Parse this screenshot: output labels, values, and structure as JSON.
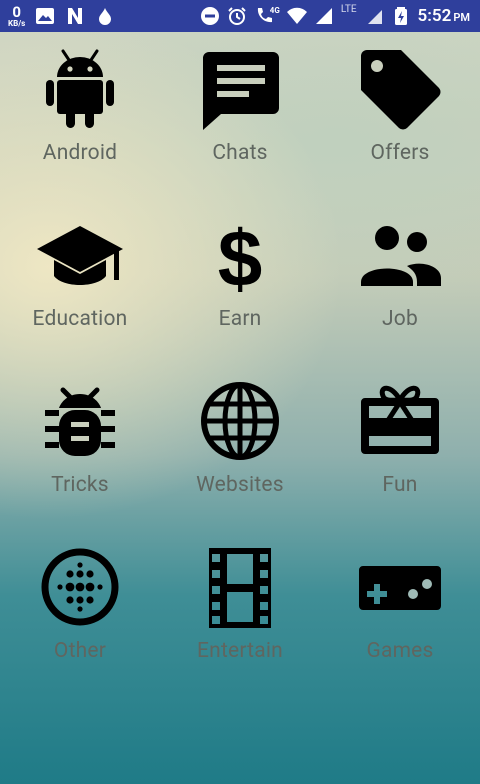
{
  "status_bar": {
    "speed_value": "0",
    "speed_unit": "KB/s",
    "network_4g": "4G",
    "network_lte": "LTE",
    "time": "5:52",
    "ampm": "PM"
  },
  "grid": {
    "items": [
      {
        "label": "Android",
        "icon": "android-icon"
      },
      {
        "label": "Chats",
        "icon": "chat-icon"
      },
      {
        "label": "Offers",
        "icon": "tag-icon"
      },
      {
        "label": "Education",
        "icon": "graduation-cap-icon"
      },
      {
        "label": "Earn",
        "icon": "dollar-icon"
      },
      {
        "label": "Job",
        "icon": "people-icon"
      },
      {
        "label": "Tricks",
        "icon": "bug-icon"
      },
      {
        "label": "Websites",
        "icon": "globe-icon"
      },
      {
        "label": "Fun",
        "icon": "gift-card-icon"
      },
      {
        "label": "Other",
        "icon": "dots-circle-icon"
      },
      {
        "label": "Entertain",
        "icon": "film-strip-icon"
      },
      {
        "label": "Games",
        "icon": "gamepad-icon"
      }
    ]
  }
}
